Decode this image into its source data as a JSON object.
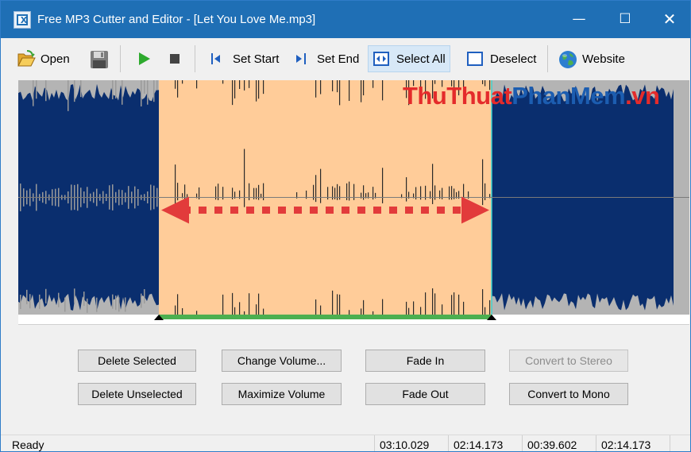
{
  "window": {
    "title": "Free MP3 Cutter and Editor - [Let You Love Me.mp3]"
  },
  "window_controls": {
    "minimize": "—",
    "maximize": "☐",
    "close": "✕"
  },
  "toolbar": {
    "open": "Open",
    "set_start": "Set Start",
    "set_end": "Set End",
    "select_all": "Select All",
    "deselect": "Deselect",
    "website": "Website"
  },
  "watermark": {
    "part1": "ThuThuat",
    "part2": "PhanMem",
    "part3": ".vn"
  },
  "waveform": {
    "colors": {
      "unselected": "#0a2e6e",
      "selected_bg": "#ffcc99",
      "selected_wave": "#2a2a2a",
      "range_bar": "#4caf50",
      "arrow": "#e23b3b"
    },
    "selection_start_fraction": 0.21,
    "selection_end_fraction": 0.705
  },
  "buttons": {
    "delete_selected": "Delete Selected",
    "change_volume": "Change Volume...",
    "fade_in": "Fade In",
    "convert_to_stereo": "Convert to Stereo",
    "delete_unselected": "Delete Unselected",
    "maximize_volume": "Maximize Volume",
    "fade_out": "Fade Out",
    "convert_to_mono": "Convert to Mono"
  },
  "status": {
    "text": "Ready",
    "total_length": "03:10.029",
    "selection_start": "02:14.173",
    "selection_length": "00:39.602",
    "cursor_position": "02:14.173"
  }
}
